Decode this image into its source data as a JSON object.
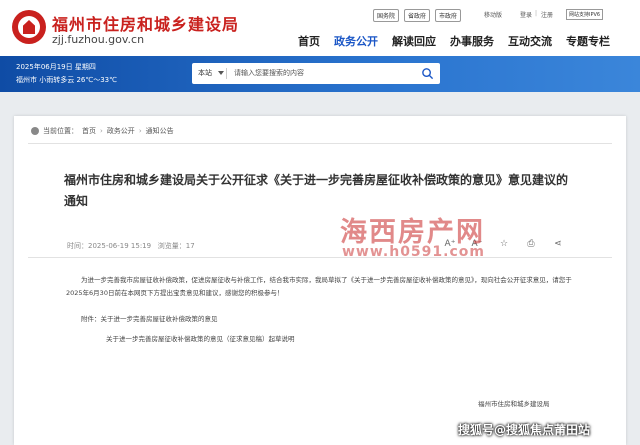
{
  "header": {
    "title": "福州市住房和城乡建设局",
    "url": "zjj.fuzhou.gov.cn",
    "top_links": [
      "国务院",
      "省政府",
      "市政府"
    ],
    "mobile": "移动版",
    "login": "登录",
    "register": "注册",
    "sep": "|",
    "ipv6": "网站支持IPV6",
    "nav": [
      "首页",
      "政务公开",
      "解读回应",
      "办事服务",
      "互动交流",
      "专题专栏"
    ]
  },
  "banner": {
    "date": "2025年06月19日 星期四",
    "weather": "福州市 小雨转多云 26℃～33℃"
  },
  "search": {
    "scope": "本站",
    "placeholder": "请输入您要搜索的内容"
  },
  "breadcrumb": {
    "prefix": "当前位置：",
    "items": [
      "首页",
      "政务公开",
      "通知公告"
    ],
    "sep": "›"
  },
  "article": {
    "title": "福州市住房和城乡建设局关于公开征求《关于进一步完善房屋征收补偿政策的意见》意见建议的通知",
    "time": "时间：2025-06-19 15:19",
    "views": "浏览量：17",
    "paragraph": "为进一步完善我市房屋征收补偿政策，促进房屋征收与补偿工作，结合我市实际，我局草拟了《关于进一步完善房屋征收补偿政策的意见》，现向社会公开征求意见，请您于2025年6月30日前在本网页下方提出宝贵意见和建议，感谢您的积极参与！",
    "attachment_label": "附件：关于进一步完善房屋征收补偿政策的意见",
    "attachment_file": "关于进一步完善房屋征收补偿政策的意见（征求意见稿）起草说明",
    "org": "福州市住房和城乡建设局"
  },
  "tools": [
    "A⁺",
    "A⁻",
    "☆",
    "⎙",
    "⋖"
  ],
  "watermark": {
    "name": "海西房产网",
    "url": "www.h0591.com",
    "source": "搜狐号@搜狐焦点莆田站"
  },
  "colors": {
    "brand_red": "#c9211e",
    "nav_active": "#1a56c6",
    "banner": "#1a5fbf"
  }
}
